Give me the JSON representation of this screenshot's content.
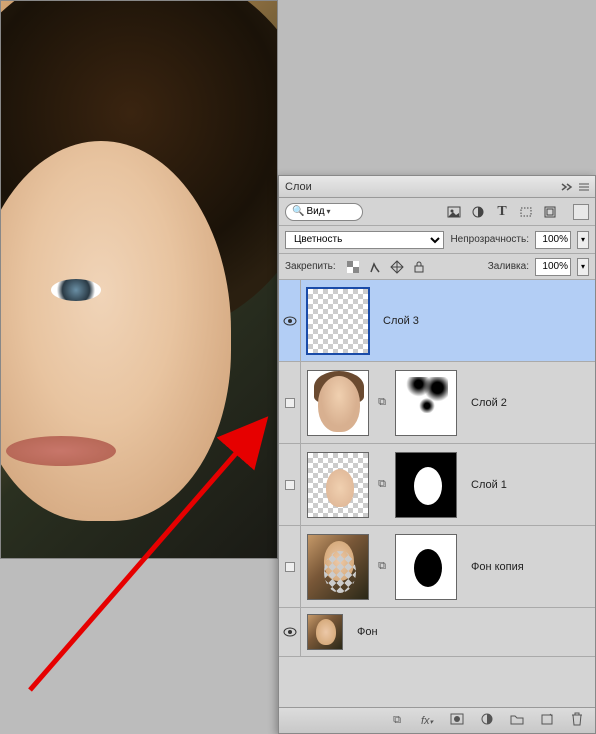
{
  "panel": {
    "title": "Слои",
    "search_label": "Вид",
    "blend_mode": "Цветность",
    "opacity_label": "Непрозрачность:",
    "opacity_value": "100%",
    "lock_label": "Закрепить:",
    "fill_label": "Заливка:",
    "fill_value": "100%"
  },
  "layers": [
    {
      "name": "Слой 3",
      "visible": true,
      "selected": true
    },
    {
      "name": "Слой 2",
      "visible": false,
      "selected": false
    },
    {
      "name": "Слой 1",
      "visible": false,
      "selected": false
    },
    {
      "name": "Фон копия",
      "visible": false,
      "selected": false
    },
    {
      "name": "Фон",
      "visible": true,
      "selected": false
    }
  ]
}
